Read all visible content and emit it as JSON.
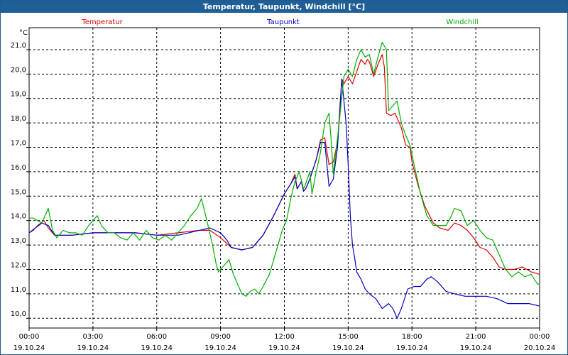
{
  "window": {
    "title": "Temperatur, Taupunkt, Windchill [°C]"
  },
  "chart_data": {
    "type": "line",
    "title": "Temperatur, Taupunkt, Windchill [°C]",
    "ylabel": "°C",
    "ylim": [
      9.6,
      21.9
    ],
    "xlim": [
      "19.10.24 00:00",
      "20.10.24 00:00"
    ],
    "x_ticks": [
      {
        "time": "00:00",
        "date": "19.10.24",
        "hour": 0
      },
      {
        "time": "03:00",
        "date": "19.10.24",
        "hour": 3
      },
      {
        "time": "06:00",
        "date": "19.10.24",
        "hour": 6
      },
      {
        "time": "09:00",
        "date": "19.10.24",
        "hour": 9
      },
      {
        "time": "12:00",
        "date": "19.10.24",
        "hour": 12
      },
      {
        "time": "15:00",
        "date": "19.10.24",
        "hour": 15
      },
      {
        "time": "18:00",
        "date": "19.10.24",
        "hour": 18
      },
      {
        "time": "21:00",
        "date": "19.10.24",
        "hour": 21
      },
      {
        "time": "00:00",
        "date": "20.10.24",
        "hour": 24
      }
    ],
    "y_ticks": [
      "10,0",
      "11,0",
      "12,0",
      "13,0",
      "14,0",
      "15,0",
      "16,0",
      "17,0",
      "18,0",
      "19,0",
      "20,0",
      "21,0"
    ],
    "grid": true,
    "legend_placement": "top",
    "series": [
      {
        "name": "Temperatur",
        "color": "#e00000",
        "points": [
          [
            0,
            13.5
          ],
          [
            0.2,
            13.6
          ],
          [
            0.4,
            13.8
          ],
          [
            0.7,
            14.0
          ],
          [
            0.9,
            13.7
          ],
          [
            1.2,
            13.4
          ],
          [
            1.6,
            13.4
          ],
          [
            2,
            13.4
          ],
          [
            3,
            13.5
          ],
          [
            4,
            13.5
          ],
          [
            5,
            13.5
          ],
          [
            6,
            13.4
          ],
          [
            7,
            13.5
          ],
          [
            8,
            13.6
          ],
          [
            8.5,
            13.6
          ],
          [
            9,
            13.3
          ],
          [
            9.5,
            12.9
          ],
          [
            10,
            12.8
          ],
          [
            10.5,
            12.9
          ],
          [
            11,
            13.4
          ],
          [
            11.5,
            14.2
          ],
          [
            12,
            15.1
          ],
          [
            12.3,
            15.5
          ],
          [
            12.5,
            15.9
          ],
          [
            12.6,
            15.3
          ],
          [
            12.8,
            15.6
          ],
          [
            12.9,
            15.2
          ],
          [
            13,
            15.3
          ],
          [
            13.2,
            15.7
          ],
          [
            13.5,
            16.5
          ],
          [
            13.7,
            17.3
          ],
          [
            13.9,
            17.4
          ],
          [
            14.1,
            16.3
          ],
          [
            14.3,
            16.4
          ],
          [
            14.5,
            17.2
          ],
          [
            14.7,
            19.8
          ],
          [
            14.8,
            19.6
          ],
          [
            15,
            19.9
          ],
          [
            15.2,
            19.6
          ],
          [
            15.4,
            20.1
          ],
          [
            15.6,
            20.6
          ],
          [
            15.8,
            20.4
          ],
          [
            15.9,
            20.6
          ],
          [
            16,
            20.5
          ],
          [
            16.2,
            19.9
          ],
          [
            16.4,
            20.4
          ],
          [
            16.6,
            20.8
          ],
          [
            16.7,
            20.3
          ],
          [
            16.8,
            18.4
          ],
          [
            17,
            18.3
          ],
          [
            17.2,
            18.4
          ],
          [
            17.5,
            17.8
          ],
          [
            17.7,
            17.1
          ],
          [
            17.9,
            17.0
          ],
          [
            18,
            16.4
          ],
          [
            18.3,
            15.4
          ],
          [
            18.6,
            14.6
          ],
          [
            19,
            13.9
          ],
          [
            19.3,
            13.7
          ],
          [
            19.7,
            13.6
          ],
          [
            20,
            13.9
          ],
          [
            20.3,
            13.8
          ],
          [
            20.6,
            13.6
          ],
          [
            20.9,
            13.3
          ],
          [
            21.2,
            12.9
          ],
          [
            21.5,
            12.8
          ],
          [
            21.8,
            12.5
          ],
          [
            22.1,
            12.1
          ],
          [
            22.4,
            12.0
          ],
          [
            22.8,
            12.0
          ],
          [
            23.2,
            12.1
          ],
          [
            23.6,
            11.9
          ],
          [
            24,
            11.8
          ]
        ]
      },
      {
        "name": "Taupunkt",
        "color": "#0000c0",
        "points": [
          [
            0,
            13.5
          ],
          [
            0.3,
            13.7
          ],
          [
            0.6,
            13.9
          ],
          [
            0.9,
            13.8
          ],
          [
            1.2,
            13.4
          ],
          [
            1.6,
            13.4
          ],
          [
            2,
            13.4
          ],
          [
            2.5,
            13.45
          ],
          [
            3,
            13.5
          ],
          [
            4,
            13.5
          ],
          [
            5,
            13.5
          ],
          [
            6,
            13.4
          ],
          [
            6.5,
            13.4
          ],
          [
            7,
            13.4
          ],
          [
            7.5,
            13.5
          ],
          [
            8,
            13.6
          ],
          [
            8.5,
            13.7
          ],
          [
            9,
            13.5
          ],
          [
            9.3,
            13.2
          ],
          [
            9.5,
            12.9
          ],
          [
            10,
            12.8
          ],
          [
            10.5,
            12.9
          ],
          [
            11,
            13.4
          ],
          [
            11.5,
            14.2
          ],
          [
            12,
            15.1
          ],
          [
            12.3,
            15.5
          ],
          [
            12.5,
            15.8
          ],
          [
            12.6,
            15.3
          ],
          [
            12.8,
            15.6
          ],
          [
            12.9,
            15.2
          ],
          [
            13,
            15.3
          ],
          [
            13.2,
            15.7
          ],
          [
            13.5,
            16.5
          ],
          [
            13.7,
            17.2
          ],
          [
            13.9,
            17.2
          ],
          [
            14.1,
            15.4
          ],
          [
            14.3,
            15.7
          ],
          [
            14.5,
            17.0
          ],
          [
            14.7,
            19.8
          ],
          [
            14.9,
            18.0
          ],
          [
            15,
            16.3
          ],
          [
            15.1,
            14.2
          ],
          [
            15.2,
            13.0
          ],
          [
            15.3,
            12.5
          ],
          [
            15.4,
            11.9
          ],
          [
            15.6,
            11.6
          ],
          [
            15.8,
            11.2
          ],
          [
            16,
            11.0
          ],
          [
            16.3,
            10.8
          ],
          [
            16.6,
            10.4
          ],
          [
            16.9,
            10.6
          ],
          [
            17.1,
            10.4
          ],
          [
            17.3,
            10.0
          ],
          [
            17.5,
            10.4
          ],
          [
            17.8,
            11.2
          ],
          [
            18.1,
            11.3
          ],
          [
            18.4,
            11.3
          ],
          [
            18.7,
            11.6
          ],
          [
            18.9,
            11.7
          ],
          [
            19.2,
            11.5
          ],
          [
            19.6,
            11.1
          ],
          [
            20,
            11.0
          ],
          [
            20.5,
            10.9
          ],
          [
            21,
            10.9
          ],
          [
            21.5,
            10.9
          ],
          [
            22,
            10.8
          ],
          [
            22.5,
            10.6
          ],
          [
            23,
            10.6
          ],
          [
            23.5,
            10.6
          ],
          [
            24,
            10.5
          ]
        ]
      },
      {
        "name": "Windchill",
        "color": "#00b000",
        "points": [
          [
            0,
            14.1
          ],
          [
            0.2,
            14.1
          ],
          [
            0.4,
            14.0
          ],
          [
            0.6,
            13.9
          ],
          [
            0.8,
            14.3
          ],
          [
            0.9,
            14.5
          ],
          [
            1.1,
            13.6
          ],
          [
            1.3,
            13.3
          ],
          [
            1.6,
            13.6
          ],
          [
            1.9,
            13.5
          ],
          [
            2.2,
            13.5
          ],
          [
            2.5,
            13.4
          ],
          [
            2.8,
            13.8
          ],
          [
            3,
            14.0
          ],
          [
            3.2,
            14.2
          ],
          [
            3.4,
            13.8
          ],
          [
            3.7,
            13.5
          ],
          [
            4,
            13.5
          ],
          [
            4.3,
            13.3
          ],
          [
            4.6,
            13.2
          ],
          [
            4.9,
            13.5
          ],
          [
            5.2,
            13.2
          ],
          [
            5.5,
            13.6
          ],
          [
            5.8,
            13.3
          ],
          [
            6.1,
            13.2
          ],
          [
            6.4,
            13.4
          ],
          [
            6.7,
            13.2
          ],
          [
            7,
            13.5
          ],
          [
            7.3,
            13.8
          ],
          [
            7.6,
            14.2
          ],
          [
            7.9,
            14.5
          ],
          [
            8.1,
            14.9
          ],
          [
            8.3,
            14.2
          ],
          [
            8.6,
            13.1
          ],
          [
            8.8,
            12.2
          ],
          [
            8.9,
            11.9
          ],
          [
            9.2,
            12.2
          ],
          [
            9.4,
            12.4
          ],
          [
            9.6,
            11.8
          ],
          [
            9.8,
            11.4
          ],
          [
            10,
            11.0
          ],
          [
            10.2,
            10.9
          ],
          [
            10.4,
            11.1
          ],
          [
            10.6,
            11.2
          ],
          [
            10.8,
            11.0
          ],
          [
            11,
            11.3
          ],
          [
            11.3,
            11.8
          ],
          [
            11.6,
            12.7
          ],
          [
            11.9,
            13.6
          ],
          [
            12.1,
            14.0
          ],
          [
            12.3,
            14.9
          ],
          [
            12.5,
            15.6
          ],
          [
            12.7,
            16.0
          ],
          [
            12.9,
            15.3
          ],
          [
            13,
            15.5
          ],
          [
            13.2,
            16.0
          ],
          [
            13.3,
            15.1
          ],
          [
            13.5,
            16.0
          ],
          [
            13.7,
            16.8
          ],
          [
            13.9,
            18.0
          ],
          [
            14.1,
            18.4
          ],
          [
            14.2,
            17.3
          ],
          [
            14.3,
            15.9
          ],
          [
            14.5,
            17.4
          ],
          [
            14.6,
            18.2
          ],
          [
            14.8,
            19.9
          ],
          [
            15,
            20.2
          ],
          [
            15.2,
            19.9
          ],
          [
            15.4,
            20.6
          ],
          [
            15.6,
            21.0
          ],
          [
            15.8,
            20.7
          ],
          [
            16,
            20.8
          ],
          [
            16.2,
            20.0
          ],
          [
            16.4,
            20.7
          ],
          [
            16.6,
            21.3
          ],
          [
            16.8,
            21.0
          ],
          [
            16.9,
            18.5
          ],
          [
            17.1,
            18.7
          ],
          [
            17.3,
            18.9
          ],
          [
            17.5,
            18.0
          ],
          [
            17.7,
            17.5
          ],
          [
            17.9,
            17.1
          ],
          [
            18.1,
            16.3
          ],
          [
            18.4,
            15.1
          ],
          [
            18.7,
            14.2
          ],
          [
            19,
            13.8
          ],
          [
            19.3,
            13.8
          ],
          [
            19.6,
            13.8
          ],
          [
            19.8,
            14.1
          ],
          [
            20,
            14.5
          ],
          [
            20.3,
            14.4
          ],
          [
            20.6,
            13.8
          ],
          [
            20.9,
            14.0
          ],
          [
            21.2,
            13.6
          ],
          [
            21.5,
            13.3
          ],
          [
            21.8,
            13.2
          ],
          [
            22.1,
            12.6
          ],
          [
            22.4,
            12.0
          ],
          [
            22.7,
            11.7
          ],
          [
            23,
            11.9
          ],
          [
            23.3,
            11.7
          ],
          [
            23.6,
            11.8
          ],
          [
            23.9,
            11.4
          ],
          [
            24,
            11.4
          ]
        ]
      }
    ]
  }
}
